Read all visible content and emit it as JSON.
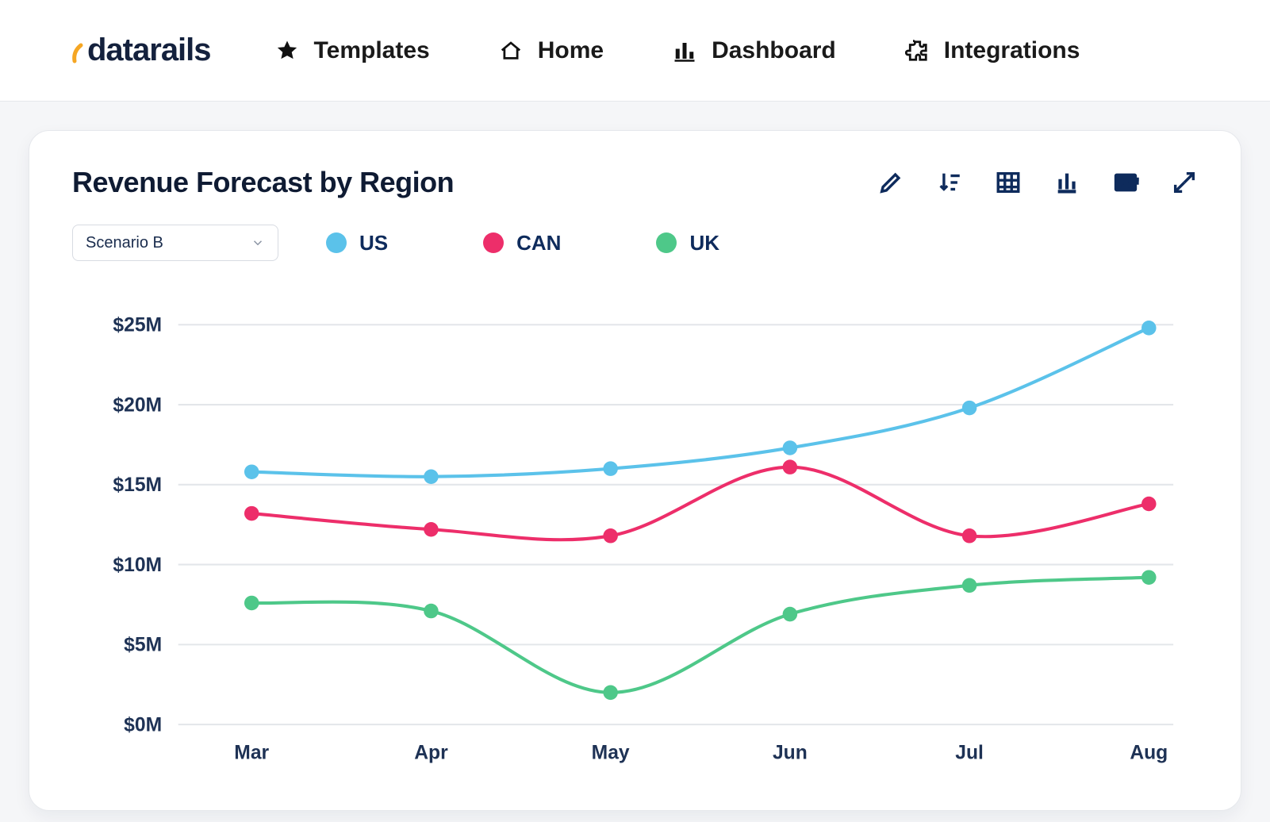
{
  "brand": {
    "name": "datarails"
  },
  "nav": {
    "items": [
      {
        "label": "Templates",
        "icon": "star-icon"
      },
      {
        "label": "Home",
        "icon": "home-icon"
      },
      {
        "label": "Dashboard",
        "icon": "bars-icon"
      },
      {
        "label": "Integrations",
        "icon": "puzzle-icon"
      }
    ]
  },
  "card": {
    "title": "Revenue Forecast by Region",
    "scenario_selected": "Scenario B"
  },
  "legend": {
    "us": "US",
    "can": "CAN",
    "uk": "UK"
  },
  "tools": {
    "edit": "edit-icon",
    "sort": "sort-icon",
    "table": "table-icon",
    "chart": "chart-icon",
    "pdf": "pdf-icon",
    "expand": "expand-icon"
  },
  "y_ticks": [
    "$0M",
    "$5M",
    "$10M",
    "$15M",
    "$20M",
    "$25M"
  ],
  "x_ticks": [
    "Mar",
    "Apr",
    "May",
    "Jun",
    "Jul",
    "Aug"
  ],
  "colors": {
    "us": "#5bc2ea",
    "can": "#ed2e6a",
    "uk": "#4ec889",
    "navy": "#0e2b5c"
  },
  "chart_data": {
    "type": "line",
    "title": "Revenue Forecast by Region",
    "xlabel": "",
    "ylabel": "",
    "ylim": [
      0,
      25
    ],
    "y_unit": "$M",
    "categories": [
      "Mar",
      "Apr",
      "May",
      "Jun",
      "Jul",
      "Aug"
    ],
    "series": [
      {
        "name": "US",
        "color": "#5bc2ea",
        "values": [
          15.8,
          15.5,
          16.0,
          17.3,
          19.8,
          24.8
        ]
      },
      {
        "name": "CAN",
        "color": "#ed2e6a",
        "values": [
          13.2,
          12.2,
          11.8,
          16.1,
          11.8,
          13.8
        ]
      },
      {
        "name": "UK",
        "color": "#4ec889",
        "values": [
          7.6,
          7.1,
          2.0,
          6.9,
          8.7,
          9.2
        ]
      }
    ],
    "legend_position": "top",
    "grid": "horizontal"
  }
}
